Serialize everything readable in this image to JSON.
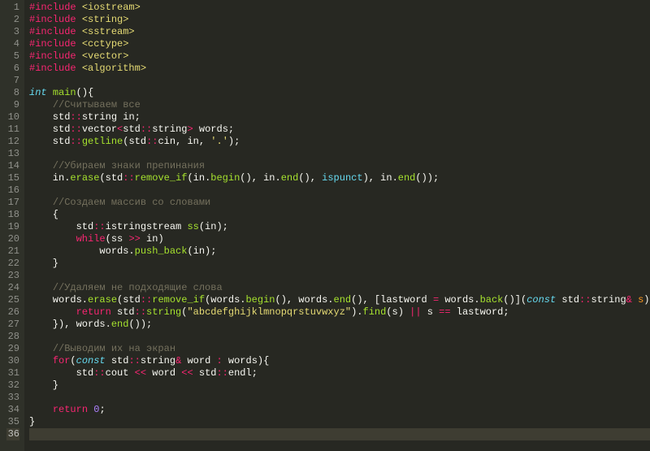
{
  "line_numbers": [
    "1",
    "2",
    "3",
    "4",
    "5",
    "6",
    "7",
    "8",
    "9",
    "10",
    "11",
    "12",
    "13",
    "14",
    "15",
    "16",
    "17",
    "18",
    "19",
    "20",
    "21",
    "22",
    "23",
    "24",
    "25",
    "26",
    "27",
    "28",
    "29",
    "30",
    "31",
    "32",
    "33",
    "34",
    "35",
    "36"
  ],
  "current_line_index": 35,
  "lines": [
    [
      [
        "kw-pre",
        "#include"
      ],
      [
        "punct",
        " "
      ],
      [
        "str",
        "<iostream>"
      ]
    ],
    [
      [
        "kw-pre",
        "#include"
      ],
      [
        "punct",
        " "
      ],
      [
        "str",
        "<string>"
      ]
    ],
    [
      [
        "kw-pre",
        "#include"
      ],
      [
        "punct",
        " "
      ],
      [
        "str",
        "<sstream>"
      ]
    ],
    [
      [
        "kw-pre",
        "#include"
      ],
      [
        "punct",
        " "
      ],
      [
        "str",
        "<cctype>"
      ]
    ],
    [
      [
        "kw-pre",
        "#include"
      ],
      [
        "punct",
        " "
      ],
      [
        "str",
        "<vector>"
      ]
    ],
    [
      [
        "kw-pre",
        "#include"
      ],
      [
        "punct",
        " "
      ],
      [
        "str",
        "<algorithm>"
      ]
    ],
    [],
    [
      [
        "kw-type",
        "int"
      ],
      [
        "punct",
        " "
      ],
      [
        "func",
        "main"
      ],
      [
        "punct",
        "(){"
      ]
    ],
    [
      [
        "punct",
        "    "
      ],
      [
        "comment",
        "//Считываем все"
      ]
    ],
    [
      [
        "punct",
        "    std"
      ],
      [
        "op",
        "::"
      ],
      [
        "ident",
        "string in"
      ],
      [
        "punct",
        ";"
      ]
    ],
    [
      [
        "punct",
        "    std"
      ],
      [
        "op",
        "::"
      ],
      [
        "ident",
        "vector"
      ],
      [
        "op",
        "<"
      ],
      [
        "ident",
        "std"
      ],
      [
        "op",
        "::"
      ],
      [
        "ident",
        "string"
      ],
      [
        "op",
        ">"
      ],
      [
        "ident",
        " words"
      ],
      [
        "punct",
        ";"
      ]
    ],
    [
      [
        "punct",
        "    std"
      ],
      [
        "op",
        "::"
      ],
      [
        "func",
        "getline"
      ],
      [
        "punct",
        "(std"
      ],
      [
        "op",
        "::"
      ],
      [
        "ident",
        "cin"
      ],
      [
        "punct",
        ", in, "
      ],
      [
        "str",
        "'.'"
      ],
      [
        "punct",
        ");"
      ]
    ],
    [],
    [
      [
        "punct",
        "    "
      ],
      [
        "comment",
        "//Убираем знаки препинания"
      ]
    ],
    [
      [
        "punct",
        "    in."
      ],
      [
        "func",
        "erase"
      ],
      [
        "punct",
        "(std"
      ],
      [
        "op",
        "::"
      ],
      [
        "func",
        "remove_if"
      ],
      [
        "punct",
        "(in."
      ],
      [
        "func",
        "begin"
      ],
      [
        "punct",
        "(), in."
      ],
      [
        "func",
        "end"
      ],
      [
        "punct",
        "(), "
      ],
      [
        "builtin",
        "ispunct"
      ],
      [
        "punct",
        "), in."
      ],
      [
        "func",
        "end"
      ],
      [
        "punct",
        "());"
      ]
    ],
    [],
    [
      [
        "punct",
        "    "
      ],
      [
        "comment",
        "//Создаем массив со словами"
      ]
    ],
    [
      [
        "punct",
        "    {"
      ]
    ],
    [
      [
        "punct",
        "        std"
      ],
      [
        "op",
        "::"
      ],
      [
        "ident",
        "istringstream "
      ],
      [
        "func",
        "ss"
      ],
      [
        "punct",
        "(in);"
      ]
    ],
    [
      [
        "punct",
        "        "
      ],
      [
        "kw-ctrl",
        "while"
      ],
      [
        "punct",
        "(ss "
      ],
      [
        "op",
        ">>"
      ],
      [
        "punct",
        " in)"
      ]
    ],
    [
      [
        "punct",
        "            words."
      ],
      [
        "func",
        "push_back"
      ],
      [
        "punct",
        "(in);"
      ]
    ],
    [
      [
        "punct",
        "    }"
      ]
    ],
    [],
    [
      [
        "punct",
        "    "
      ],
      [
        "comment",
        "//Удаляем не подходящие слова"
      ]
    ],
    [
      [
        "punct",
        "    words."
      ],
      [
        "func",
        "erase"
      ],
      [
        "punct",
        "(std"
      ],
      [
        "op",
        "::"
      ],
      [
        "func",
        "remove_if"
      ],
      [
        "punct",
        "(words."
      ],
      [
        "func",
        "begin"
      ],
      [
        "punct",
        "(), words."
      ],
      [
        "func",
        "end"
      ],
      [
        "punct",
        "(), [lastword "
      ],
      [
        "op",
        "="
      ],
      [
        "punct",
        " words."
      ],
      [
        "func",
        "back"
      ],
      [
        "punct",
        "()]("
      ],
      [
        "kw-type",
        "const"
      ],
      [
        "punct",
        " std"
      ],
      [
        "op",
        "::"
      ],
      [
        "ident",
        "string"
      ],
      [
        "op",
        "&"
      ],
      [
        "punct",
        " "
      ],
      [
        "param",
        "s"
      ],
      [
        "punct",
        "){"
      ]
    ],
    [
      [
        "punct",
        "        "
      ],
      [
        "kw-ctrl",
        "return"
      ],
      [
        "punct",
        " std"
      ],
      [
        "op",
        "::"
      ],
      [
        "func",
        "string"
      ],
      [
        "punct",
        "("
      ],
      [
        "str",
        "\"abcdefghijklmnopqrstuvwxyz\""
      ],
      [
        "punct",
        ")."
      ],
      [
        "func",
        "find"
      ],
      [
        "punct",
        "(s) "
      ],
      [
        "op",
        "||"
      ],
      [
        "punct",
        " s "
      ],
      [
        "op",
        "=="
      ],
      [
        "punct",
        " lastword;"
      ]
    ],
    [
      [
        "punct",
        "    }), words."
      ],
      [
        "func",
        "end"
      ],
      [
        "punct",
        "());"
      ]
    ],
    [],
    [
      [
        "punct",
        "    "
      ],
      [
        "comment",
        "//Выводим их на экран"
      ]
    ],
    [
      [
        "punct",
        "    "
      ],
      [
        "kw-ctrl",
        "for"
      ],
      [
        "punct",
        "("
      ],
      [
        "kw-type",
        "const"
      ],
      [
        "punct",
        " std"
      ],
      [
        "op",
        "::"
      ],
      [
        "ident",
        "string"
      ],
      [
        "op",
        "&"
      ],
      [
        "punct",
        " word "
      ],
      [
        "op",
        ":"
      ],
      [
        "punct",
        " words){"
      ]
    ],
    [
      [
        "punct",
        "        std"
      ],
      [
        "op",
        "::"
      ],
      [
        "ident",
        "cout "
      ],
      [
        "op",
        "<<"
      ],
      [
        "punct",
        " word "
      ],
      [
        "op",
        "<<"
      ],
      [
        "punct",
        " std"
      ],
      [
        "op",
        "::"
      ],
      [
        "ident",
        "endl"
      ],
      [
        "punct",
        ";"
      ]
    ],
    [
      [
        "punct",
        "    }"
      ]
    ],
    [],
    [
      [
        "punct",
        "    "
      ],
      [
        "kw-ctrl",
        "return"
      ],
      [
        "punct",
        " "
      ],
      [
        "num",
        "0"
      ],
      [
        "punct",
        ";"
      ]
    ],
    [
      [
        "punct",
        "}"
      ]
    ],
    []
  ]
}
